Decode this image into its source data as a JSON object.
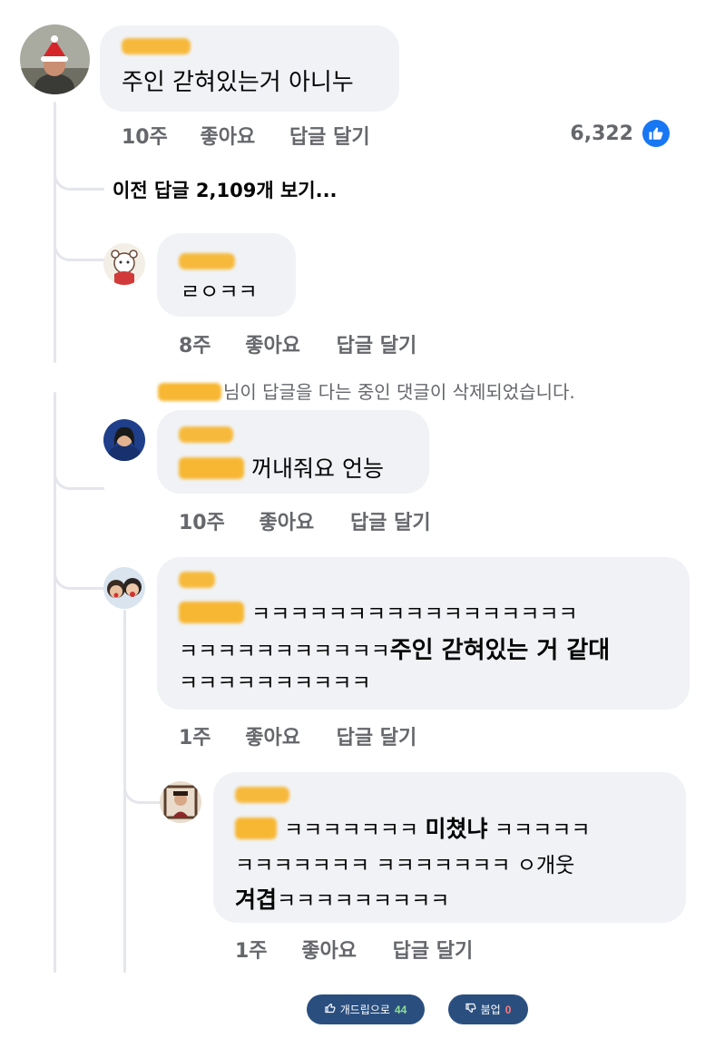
{
  "top_comment": {
    "text": "주인 갇혀있는거 아니누",
    "time": "10주",
    "like_label": "좋아요",
    "reply_label": "답글 달기",
    "like_count": "6,322",
    "like_icon": "thumbs-up-icon"
  },
  "previous_replies_label": "이전 답글 2,109개 보기...",
  "replies": [
    {
      "text": "ㄹㅇㅋㅋ",
      "time": "8주",
      "like_label": "좋아요",
      "reply_label": "답글 달기"
    },
    {
      "text": "꺼내줘요 언능",
      "time": "10주",
      "like_label": "좋아요",
      "reply_label": "답글 달기"
    },
    {
      "line1": "ㅋㅋㅋㅋㅋㅋㅋㅋㅋㅋㅋㅋㅋㅋㅋㅋㅋ",
      "line2_prefix": "ㅋㅋㅋㅋㅋㅋㅋㅋㅋㅋㅋ",
      "line2_bold": "주인 갇혀있는 거 같대",
      "line3": "ㅋㅋㅋㅋㅋㅋㅋㅋㅋㅋ",
      "time": "1주",
      "like_label": "좋아요",
      "reply_label": "답글 달기"
    },
    {
      "line1_a": "ㅋㅋㅋㅋㅋㅋㅋ",
      "line1_bold": "미쳤냐",
      "line1_b": "ㅋㅋㅋㅋㅋ",
      "line2": "ㅋㅋㅋㅋㅋㅋㅋ ㅋㅋㅋㅋㅋㅋㅋ ㅇ개웃",
      "line3_bold": "겨겹",
      "line3_rest": "ㅋㅋㅋㅋㅋㅋㅋㅋㅋ",
      "time": "1주",
      "like_label": "좋아요",
      "reply_label": "답글 달기"
    }
  ],
  "deleted_notice": "님이 답글을 다는 중인 댓글이 삭제되었습니다.",
  "vote": {
    "up_label": "개드립으로",
    "up_count": "44",
    "up_icon": "thumbs-up-icon",
    "down_label": "붐업",
    "down_count": "0",
    "down_icon": "thumbs-down-icon"
  },
  "colors": {
    "bubble": "#f0f2f5",
    "meta_text": "#65676b",
    "like_badge": "#1877f2",
    "redaction": "#f7b733",
    "vote_button": "#2a4f7f"
  }
}
